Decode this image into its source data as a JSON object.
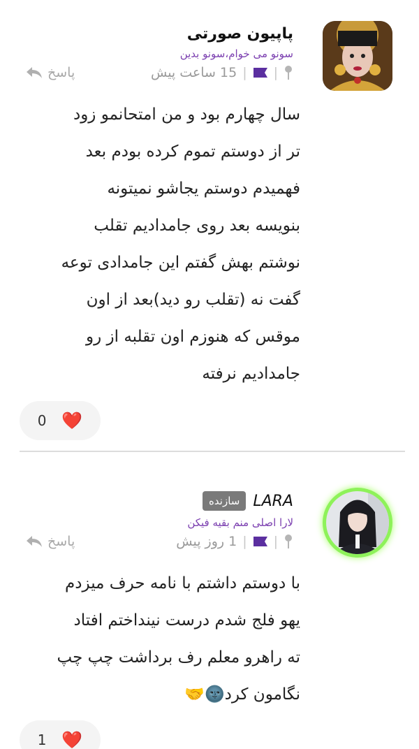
{
  "comments": [
    {
      "author": "پاپیون صورتی",
      "bio": "سونو می خوام،سونو بدین",
      "time": "15 ساعت پیش",
      "reply_label": "پاسخ",
      "lines": [
        "سال چهارم بود و من امتحانمو زود",
        "تر از دوستم تموم کرده بودم بعد",
        "فهمیدم دوستم یجاشو نمیتونه",
        "بنویسه بعد روی جامدادیم تقلب",
        "نوشتم بهش گفتم این جامدادی توعه",
        "گفت نه (تقلب رو دید)بعد از اون",
        "موقس که هنوزم اون تقلبه از رو",
        "جامدادیم نرفته"
      ],
      "likes": "0"
    },
    {
      "author": "LARA",
      "badge": "سازنده",
      "bio": "لارا اصلی منم بقیه فیکن",
      "time": "1 روز پیش",
      "reply_label": "پاسخ",
      "lines": [
        "با دوستم داشتم با نامه حرف میزدم",
        "یهو فلج شدم درست نینداختم افتاد",
        "ته راهرو معلم رف برداشت چپ چپ",
        "نگامون کرد🌚🤝"
      ],
      "likes": "1"
    }
  ],
  "icons": {
    "pin": "pin-icon",
    "flag": "flag-icon",
    "reply": "reply-arrow-icon",
    "heart": "heart-icon"
  },
  "colors": {
    "bio": "#7b3fb0",
    "flag": "#5b2fa0",
    "badge": "#7a7a7a",
    "avatar_ring": "#8ef25a"
  }
}
